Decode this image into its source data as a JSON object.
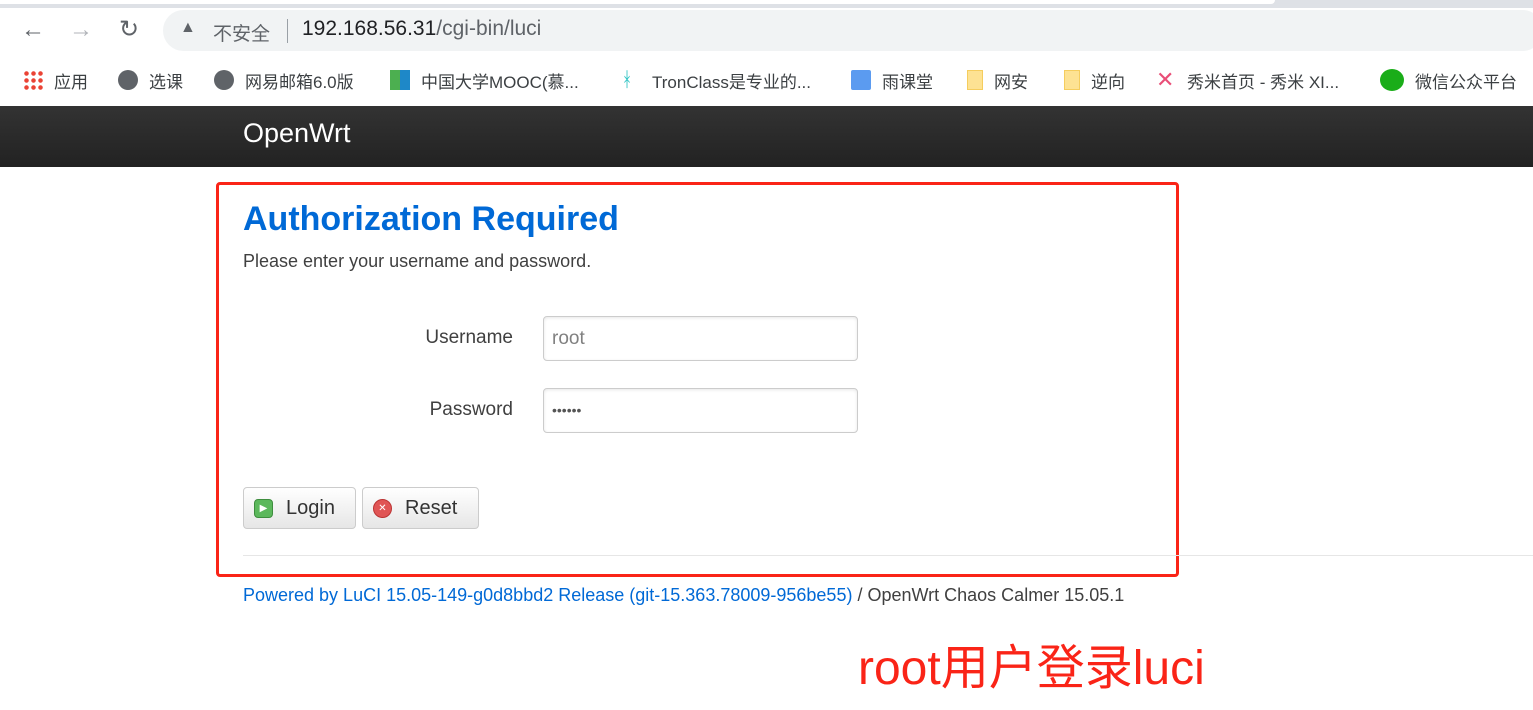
{
  "browser": {
    "url_warning": "不安全",
    "url_host": "192.168.56.31",
    "url_path": "/cgi-bin/luci",
    "bookmarks": [
      {
        "label": "应用",
        "icon": "apps-grid-icon"
      },
      {
        "label": "选课",
        "icon": "globe-icon"
      },
      {
        "label": "网易邮箱6.0版",
        "icon": "globe-icon"
      },
      {
        "label": "中国大学MOOC(慕...",
        "icon": "mooc-icon"
      },
      {
        "label": "TronClass是专业的...",
        "icon": "tronclass-icon"
      },
      {
        "label": "雨课堂",
        "icon": "yuketang-icon"
      },
      {
        "label": "网安",
        "icon": "folder-icon"
      },
      {
        "label": "逆向",
        "icon": "folder-icon"
      },
      {
        "label": "秀米首页 - 秀米 XI...",
        "icon": "xiumi-icon"
      },
      {
        "label": "微信公众平台",
        "icon": "wechat-icon"
      }
    ]
  },
  "header": {
    "brand": "OpenWrt"
  },
  "login": {
    "title": "Authorization Required",
    "subtitle": "Please enter your username and password.",
    "username_label": "Username",
    "username_value": "root",
    "password_label": "Password",
    "password_value": "••••••",
    "login_label": "Login",
    "reset_label": "Reset"
  },
  "footer": {
    "link": "Powered by LuCI 15.05-149-g0d8bbd2 Release (git-15.363.78009-956be55)",
    "rest": " / OpenWrt Chaos Calmer 15.05.1"
  },
  "annotation": "root用户登录luci",
  "colors": {
    "accent": "#0069d6",
    "annotation": "#fa2417"
  }
}
